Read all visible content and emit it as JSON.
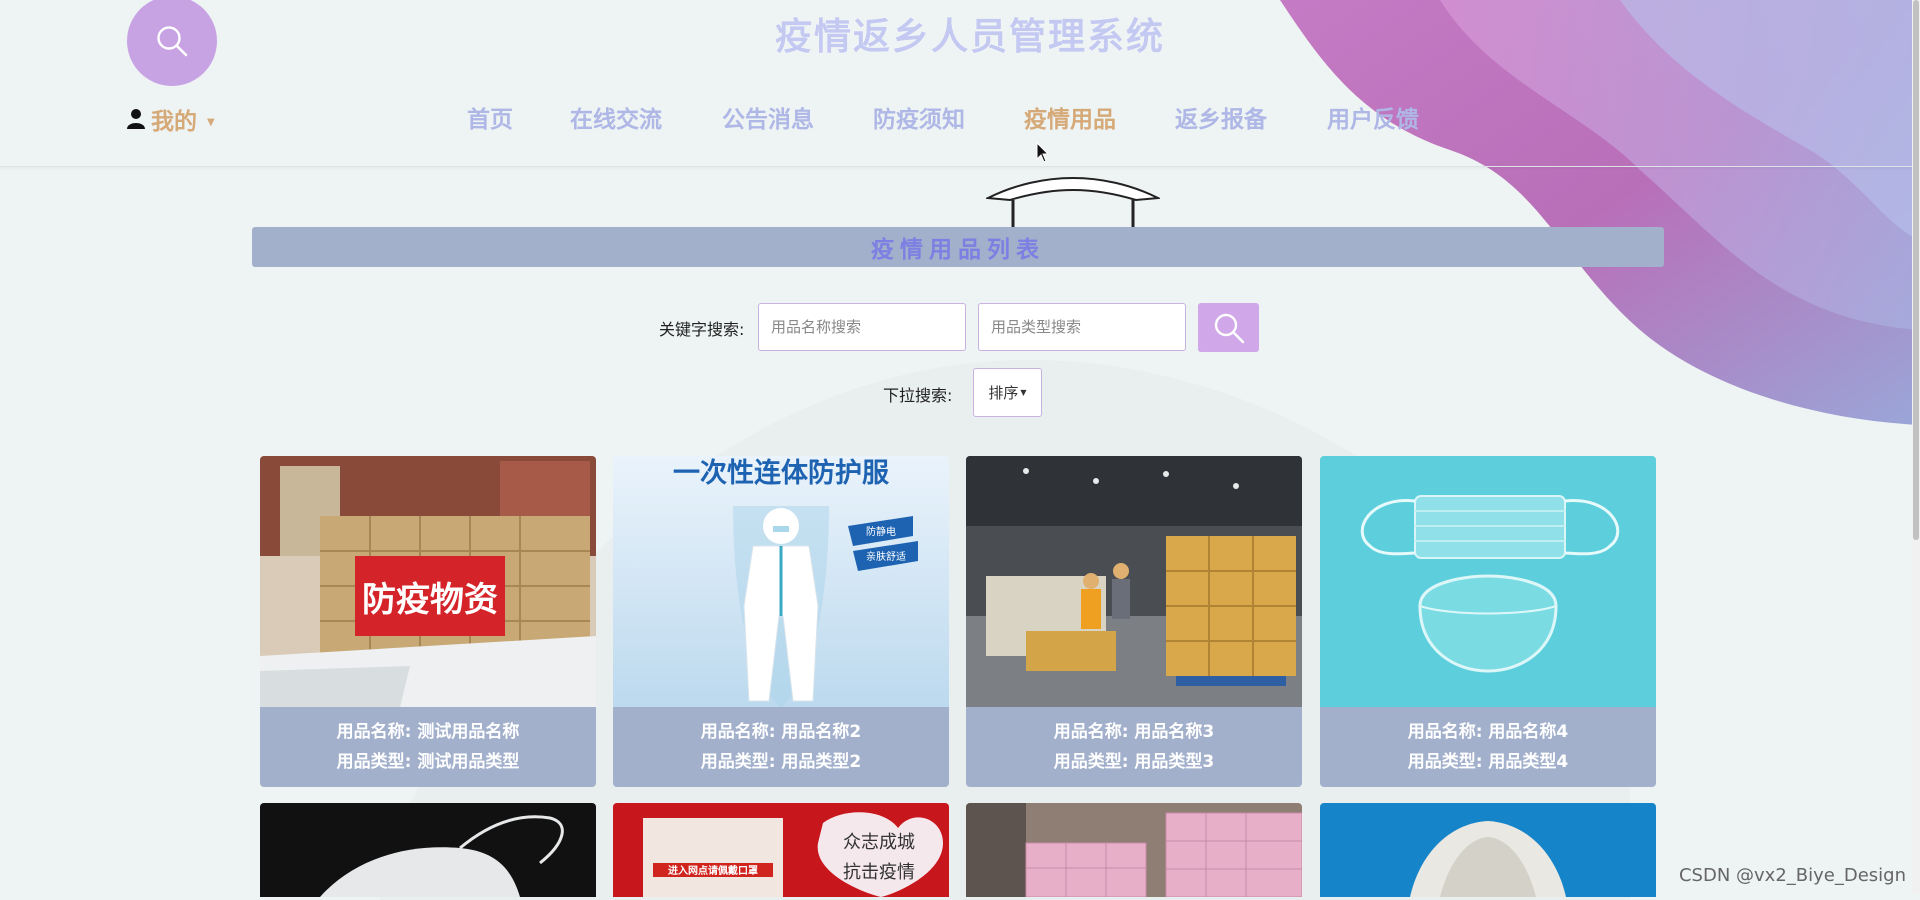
{
  "header": {
    "site_title": "疫情返乡人员管理系统",
    "user_menu_label": "我的"
  },
  "nav": {
    "items": [
      "首页",
      "在线交流",
      "公告消息",
      "防疫须知",
      "疫情用品",
      "返乡报备",
      "用户反馈"
    ],
    "active_index": 4
  },
  "list": {
    "title": "疫情用品列表"
  },
  "search": {
    "keyword_label": "关键字搜索:",
    "name_placeholder": "用品名称搜索",
    "type_placeholder": "用品类型搜索",
    "dropdown_label": "下拉搜索:",
    "sort_label": "排序"
  },
  "cards": [
    {
      "name_line": "用品名称: 测试用品名称",
      "type_line": "用品类型: 测试用品类型",
      "image_text": "防疫物资"
    },
    {
      "name_line": "用品名称: 用品名称2",
      "type_line": "用品类型: 用品类型2",
      "image_text": "一次性连体防护服",
      "badge_1": "防静电",
      "badge_2": "亲肤舒适"
    },
    {
      "name_line": "用品名称: 用品名称3",
      "type_line": "用品类型: 用品类型3"
    },
    {
      "name_line": "用品名称: 用品名称4",
      "type_line": "用品类型: 用品类型4"
    }
  ],
  "second_row": [
    {
      "image": "surgical mask on black"
    },
    {
      "image": "poster",
      "poster_text": "进入网点请佩戴口罩",
      "sign_text_1": "众志成城",
      "sign_text_2": "抗击疫情"
    },
    {
      "image": "pink boxes in warehouse"
    },
    {
      "image": "N95 mask on blue"
    }
  ],
  "watermark": "CSDN @vx2_Biye_Design",
  "colors": {
    "accent_purple": "#c7a3e4",
    "nav_text": "#aeb7e6",
    "nav_active": "#d6a978",
    "bar_bg": "#a2b0cc",
    "bar_title": "#7e7fe2"
  }
}
